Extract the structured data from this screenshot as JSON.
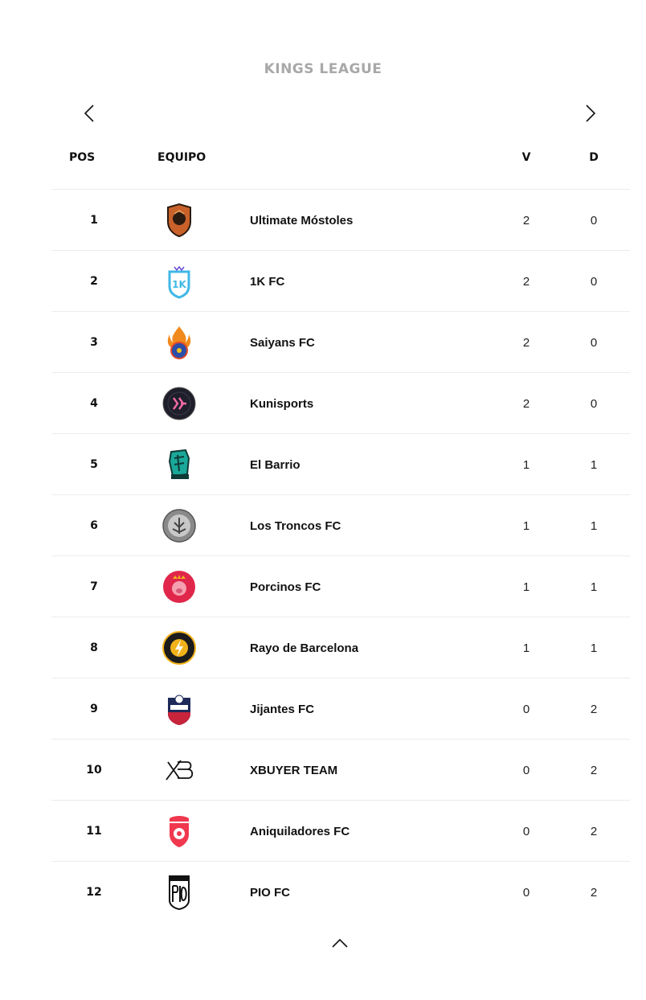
{
  "league": {
    "title": "KINGS LEAGUE"
  },
  "nav": {
    "prev_icon": "chevron-left-icon",
    "next_icon": "chevron-right-icon",
    "collapse_icon": "chevron-up-icon"
  },
  "table": {
    "headers": {
      "pos": "POS",
      "team": "EQUIPO",
      "wins": "V",
      "losses": "D"
    },
    "rows": [
      {
        "pos": "1",
        "team": "Ultimate Móstoles",
        "wins": "2",
        "losses": "0",
        "logo": "ultimate-mostoles-crest",
        "color": "#c8612a"
      },
      {
        "pos": "2",
        "team": "1K FC",
        "wins": "2",
        "losses": "0",
        "logo": "1k-fc-crest",
        "color": "#3fb7e6"
      },
      {
        "pos": "3",
        "team": "Saiyans FC",
        "wins": "2",
        "losses": "0",
        "logo": "saiyans-fc-crest",
        "color": "#f08a1c"
      },
      {
        "pos": "4",
        "team": "Kunisports",
        "wins": "2",
        "losses": "0",
        "logo": "kunisports-crest",
        "color": "#1f1f2b"
      },
      {
        "pos": "5",
        "team": "El Barrio",
        "wins": "1",
        "losses": "1",
        "logo": "el-barrio-crest",
        "color": "#1aa89a"
      },
      {
        "pos": "6",
        "team": "Los Troncos FC",
        "wins": "1",
        "losses": "1",
        "logo": "los-troncos-crest",
        "color": "#9a9a9a"
      },
      {
        "pos": "7",
        "team": "Porcinos FC",
        "wins": "1",
        "losses": "1",
        "logo": "porcinos-fc-crest",
        "color": "#e0264a"
      },
      {
        "pos": "8",
        "team": "Rayo de Barcelona",
        "wins": "1",
        "losses": "1",
        "logo": "rayo-barcelona-crest",
        "color": "#f2b21b"
      },
      {
        "pos": "9",
        "team": "Jijantes FC",
        "wins": "0",
        "losses": "2",
        "logo": "jijantes-fc-crest",
        "color": "#c8243c"
      },
      {
        "pos": "10",
        "team": "XBUYER TEAM",
        "wins": "0",
        "losses": "2",
        "logo": "xbuyer-team-crest",
        "color": "#111111"
      },
      {
        "pos": "11",
        "team": "Aniquiladores FC",
        "wins": "0",
        "losses": "2",
        "logo": "aniquiladores-fc-crest",
        "color": "#f0384e"
      },
      {
        "pos": "12",
        "team": "PIO FC",
        "wins": "0",
        "losses": "2",
        "logo": "pio-fc-crest",
        "color": "#111111"
      }
    ]
  }
}
